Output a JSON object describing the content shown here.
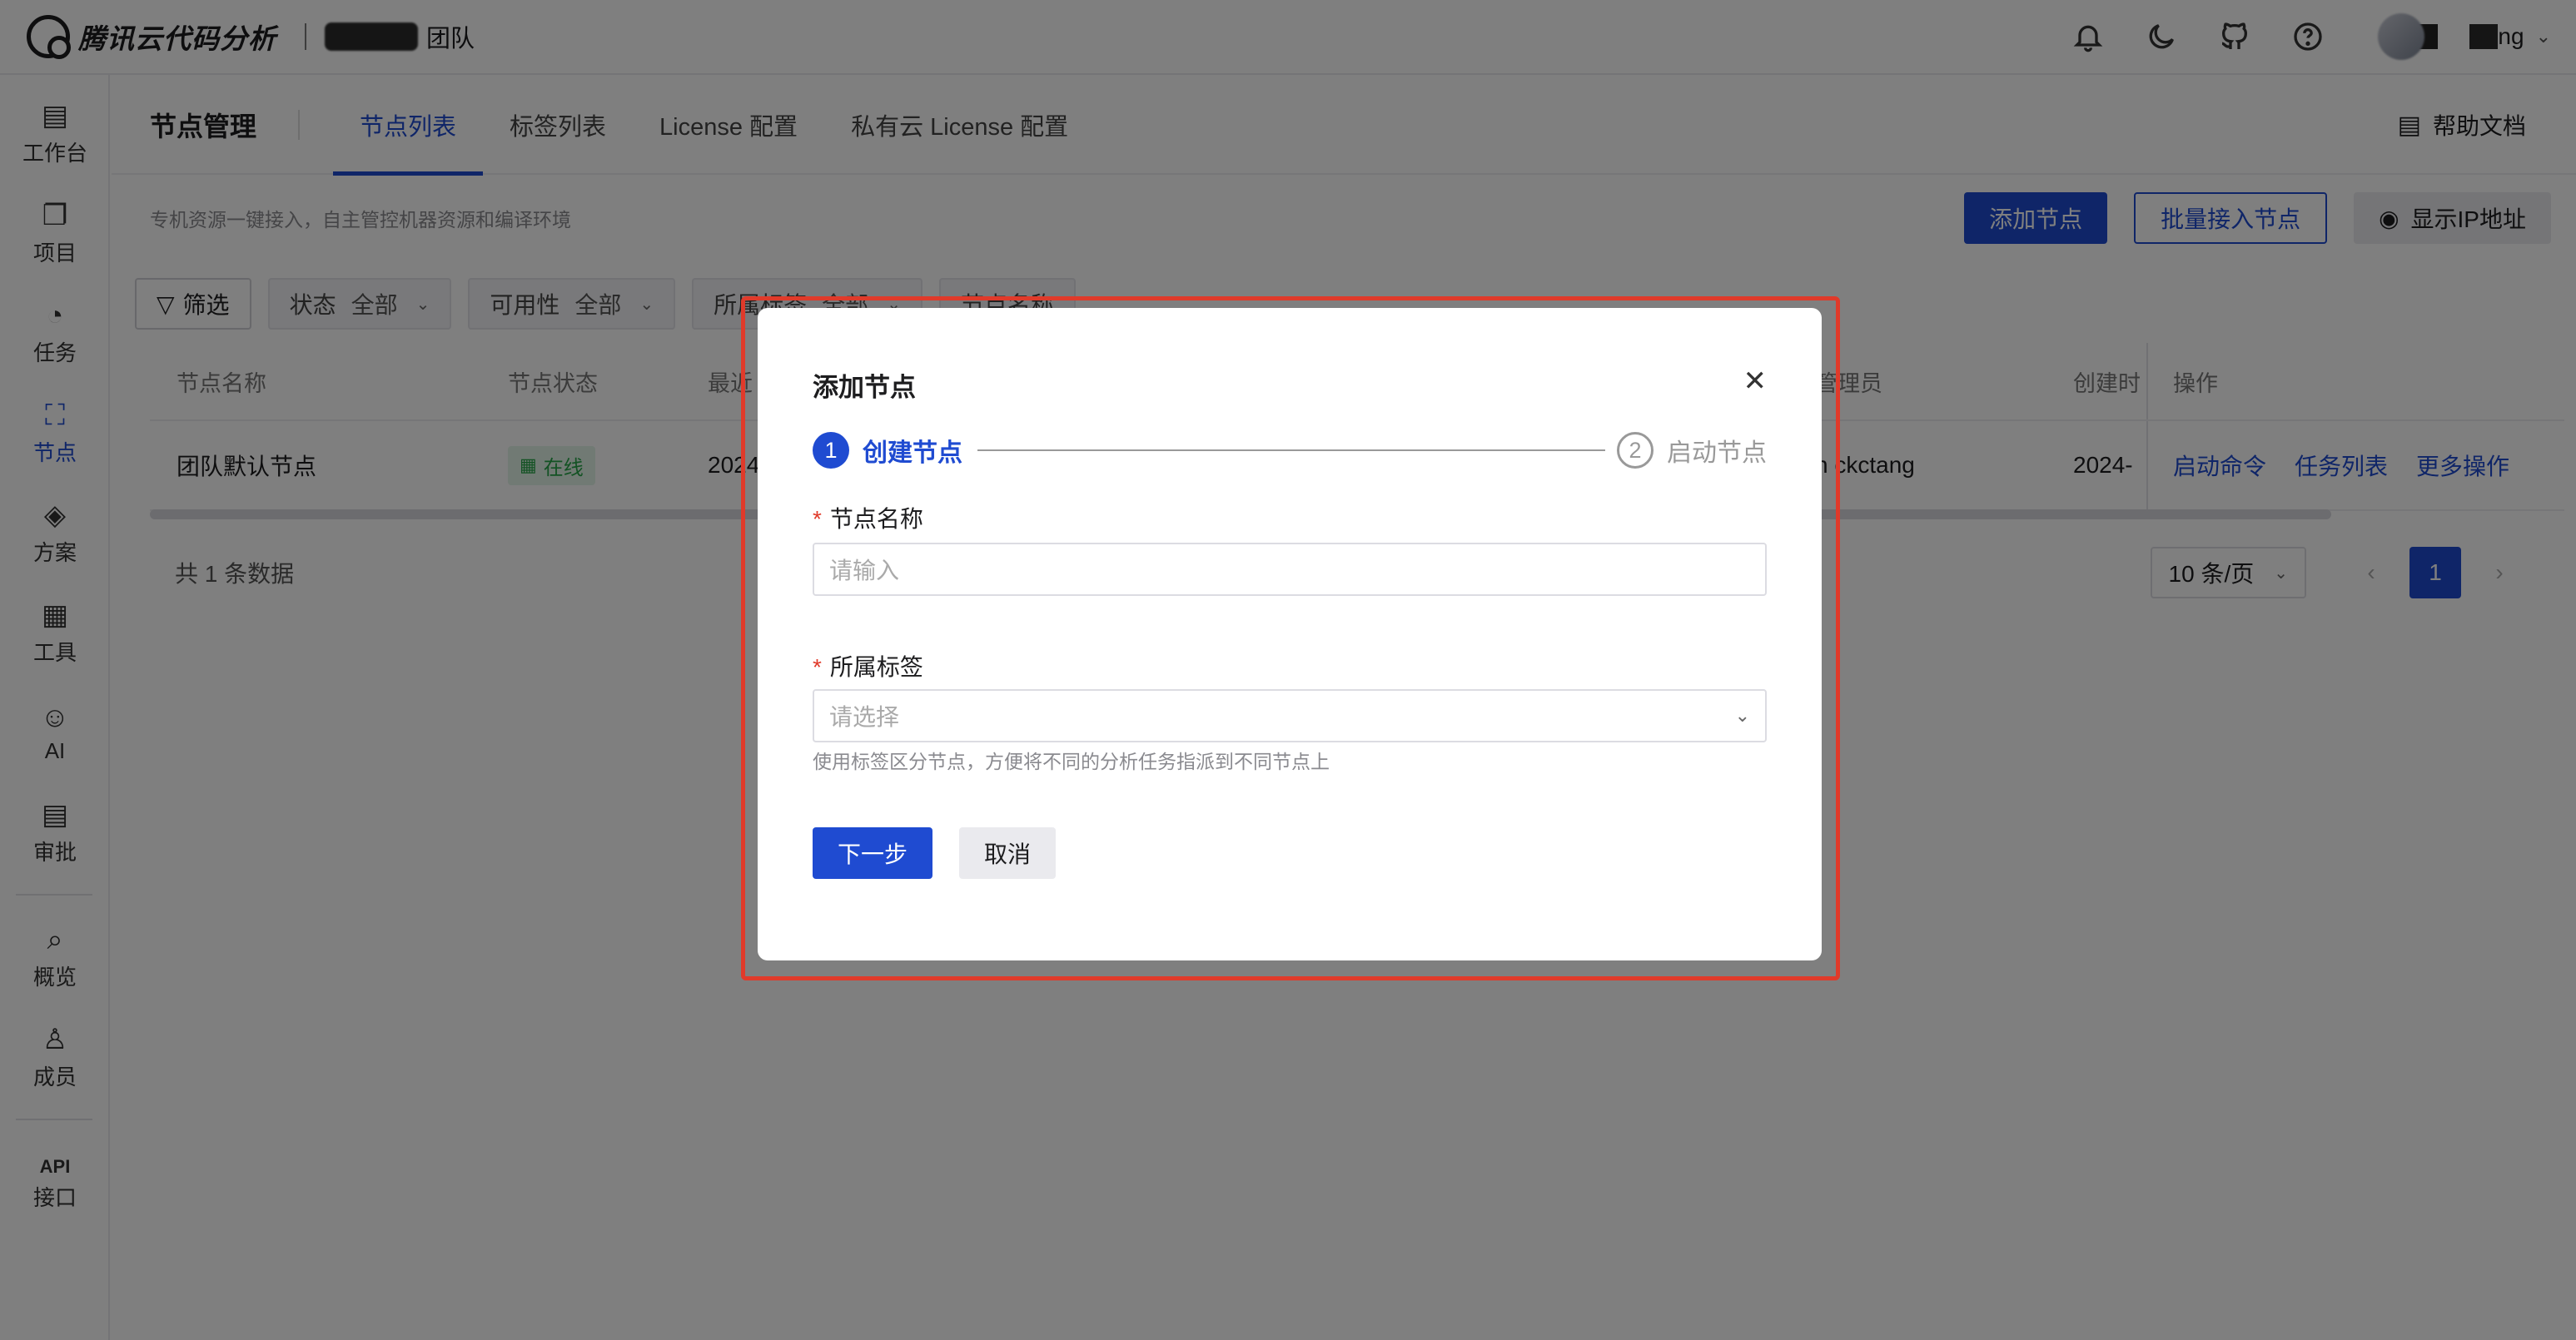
{
  "header": {
    "brand": "腾讯云代码分析",
    "team_suffix": "团队",
    "user_suffix": "ng"
  },
  "sidebar": {
    "items": [
      {
        "label": "工作台",
        "icon": "workbench-icon",
        "glyph": "▤"
      },
      {
        "label": "项目",
        "icon": "project-icon",
        "glyph": "❐"
      },
      {
        "label": "任务",
        "icon": "task-icon",
        "glyph": "◔"
      },
      {
        "label": "节点",
        "icon": "node-icon",
        "glyph": "⛶",
        "active": true
      },
      {
        "label": "方案",
        "icon": "scheme-icon",
        "glyph": "◈"
      },
      {
        "label": "工具",
        "icon": "tools-icon",
        "glyph": "▦"
      },
      {
        "label": "AI",
        "icon": "ai-icon",
        "glyph": "☺"
      },
      {
        "label": "审批",
        "icon": "approval-icon",
        "glyph": "▤"
      }
    ],
    "items_bottom": [
      {
        "label": "概览",
        "icon": "overview-icon",
        "glyph": "⌕"
      },
      {
        "label": "成员",
        "icon": "members-icon",
        "glyph": "♙"
      }
    ],
    "api": {
      "line1": "API",
      "line2": "接口"
    }
  },
  "subnav": {
    "title": "节点管理",
    "tabs": [
      "节点列表",
      "标签列表",
      "License 配置",
      "私有云 License 配置"
    ],
    "active_tab": 0,
    "help": "帮助文档"
  },
  "toolbar": {
    "description": "专机资源一键接入，自主管控机器资源和编译环境",
    "add_node": "添加节点",
    "batch_add": "批量接入节点",
    "show_ip": "显示IP地址"
  },
  "filters": {
    "filter_button": "筛选",
    "status_label": "状态",
    "status_value": "全部",
    "availability_label": "可用性",
    "availability_value": "全部",
    "tag_label": "所属标签",
    "tag_value": "全部",
    "name_label": "节点名称"
  },
  "table": {
    "columns": {
      "name": "节点名称",
      "status": "节点状态",
      "recent": "最近",
      "admin": "管理员",
      "created": "创建时",
      "ops": "操作"
    },
    "rows": [
      {
        "name": "团队默认节点",
        "status": "在线",
        "recent": "2024",
        "admin": "n ckctang",
        "created": "2024-",
        "ops": [
          "启动命令",
          "任务列表",
          "更多操作"
        ]
      }
    ]
  },
  "footer": {
    "total": "共 1 条数据",
    "page_size": "10 条/页",
    "current_page": "1"
  },
  "modal": {
    "title": "添加节点",
    "steps": [
      {
        "num": "1",
        "label": "创建节点",
        "active": true
      },
      {
        "num": "2",
        "label": "启动节点",
        "active": false
      }
    ],
    "name_label": "节点名称",
    "name_placeholder": "请输入",
    "tag_label": "所属标签",
    "tag_placeholder": "请选择",
    "tag_hint": "使用标签区分节点，方便将不同的分析任务指派到不同节点上",
    "next_button": "下一步",
    "cancel_button": "取消"
  },
  "colors": {
    "accent": "#1f4bd1",
    "highlight_border": "#e03a2a",
    "online_green": "#27a448"
  }
}
